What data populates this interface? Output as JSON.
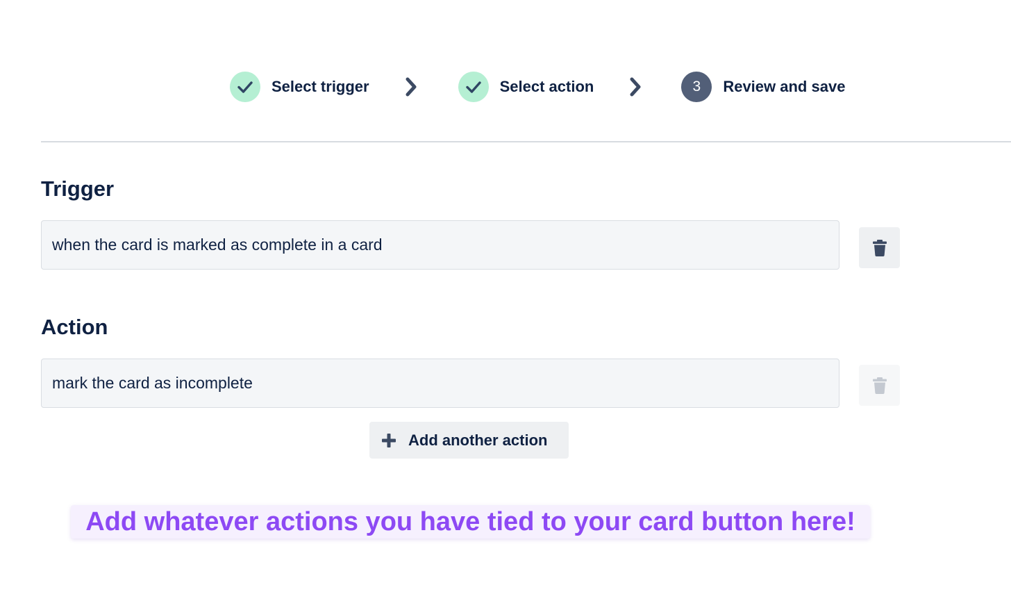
{
  "stepper": {
    "steps": [
      {
        "label": "Select trigger",
        "status": "complete",
        "icon": "check-icon"
      },
      {
        "label": "Select action",
        "status": "complete",
        "icon": "check-icon"
      },
      {
        "label": "Review and save",
        "status": "current",
        "number": "3"
      }
    ],
    "separator_icon": "chevron-right-icon"
  },
  "trigger": {
    "title": "Trigger",
    "value": "when the card is marked as complete in a card",
    "delete_icon": "trash-icon"
  },
  "action": {
    "title": "Action",
    "value": "mark the card as incomplete",
    "delete_icon": "trash-icon",
    "delete_disabled": true,
    "add_label": "Add another action",
    "add_icon": "plus-icon"
  },
  "callout": {
    "text": "Add whatever actions you have tied to your card button here!"
  },
  "colors": {
    "text": "#0f2142",
    "step_complete_bg": "#b5efd3",
    "step_current_bg": "#525f78",
    "icon": "#3c4a63",
    "callout_text": "#8d49f4",
    "callout_bg": "#f6f0fe",
    "field_bg": "#f4f6f8",
    "disabled_icon": "#c4c9d1"
  }
}
